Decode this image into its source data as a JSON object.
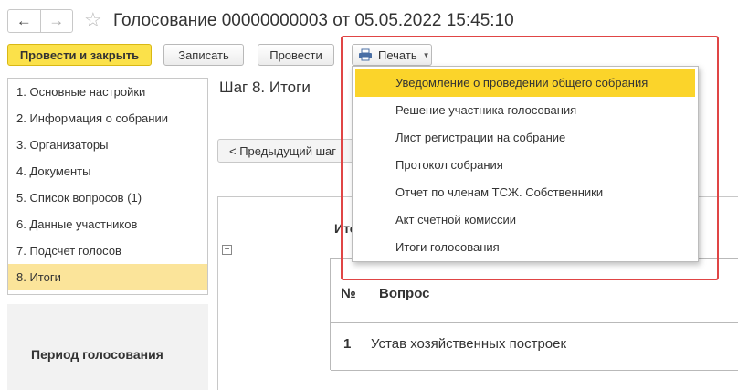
{
  "window": {
    "title": "Голосование 00000000003 от 05.05.2022 15:45:10"
  },
  "nav": {
    "back_icon": "←",
    "forward_icon": "→",
    "favorite_icon": "☆"
  },
  "toolbar": {
    "post_close_label": "Провести и закрыть",
    "write_label": "Записать",
    "post_label": "Провести",
    "print_label": "Печать"
  },
  "print_menu": {
    "items": [
      "Уведомление о проведении общего собрания",
      "Решение участника голосования",
      "Лист регистрации на собрание",
      "Протокол собрания",
      "Отчет по членам ТСЖ. Собственники",
      "Акт счетной комиссии",
      "Итоги голосования"
    ]
  },
  "steps": {
    "items": [
      "1. Основные настройки",
      "2. Информация о собрании",
      "3. Организаторы",
      "4. Документы",
      "5. Список вопросов (1)",
      "6. Данные участников",
      "7. Подсчет голосов",
      "8. Итоги"
    ]
  },
  "main": {
    "step_heading": "Шаг 8. Итоги",
    "prev_button": "< Предыдущий шаг",
    "results_label": "Итоги",
    "expand_icon": "+",
    "table": {
      "col_num": "№",
      "col_question": "Вопрос",
      "rows": [
        {
          "num": "1",
          "question": "Устав хозяйственных построек"
        }
      ]
    }
  },
  "sidebar": {
    "period_label": "Период голосования"
  },
  "colors": {
    "primary_button": "#fbe14a",
    "menu_highlight": "#fbd42a",
    "active_step": "#fbe49a",
    "highlight_frame": "#e04545"
  }
}
